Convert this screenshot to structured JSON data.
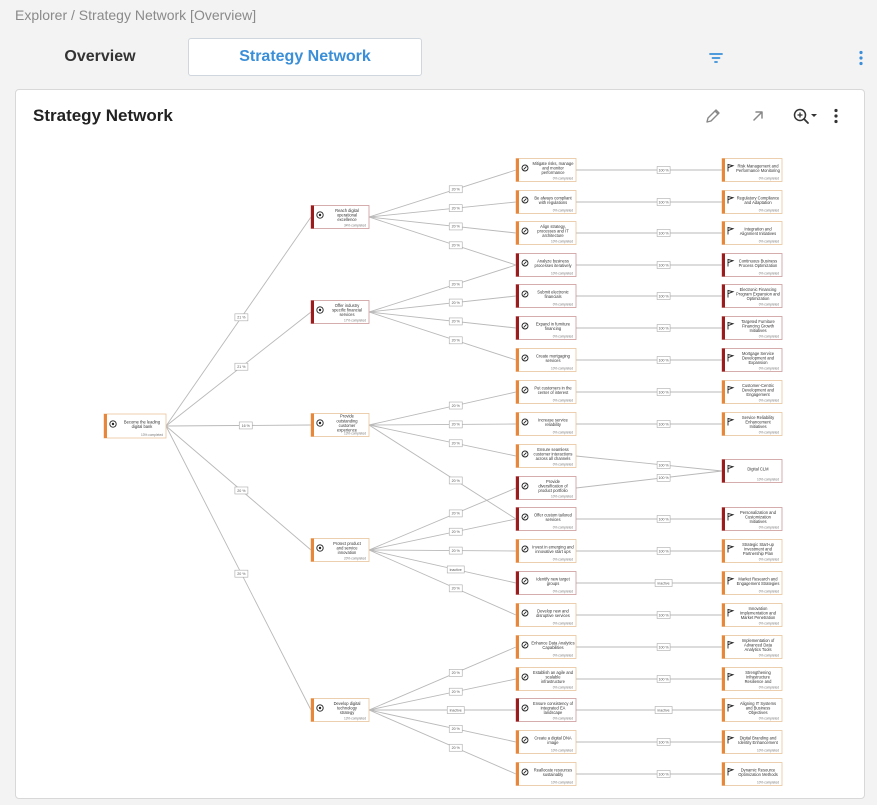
{
  "breadcrumb": "Explorer / Strategy Network [Overview]",
  "tabs": {
    "overview": "Overview",
    "strategy_network": "Strategy Network"
  },
  "panel": {
    "title": "Strategy Network"
  },
  "icons": {
    "filter": "filter-icon",
    "more": "more-vert-icon",
    "edit": "pencil-icon",
    "expand": "arrow-up-right-icon",
    "zoom": "zoom-in-icon"
  },
  "colors": {
    "accent": "#3a8fd8",
    "dark_red": "#9b1c1c",
    "orange": "#e8873a",
    "edge": "#b9b9b9"
  },
  "network": {
    "root": {
      "label": "Become the leading digital bank",
      "status": "13% completed"
    },
    "goals": [
      {
        "label": "Reach digital operational excellence",
        "status": "34% completed",
        "type": "dark",
        "edge_label": "21 %"
      },
      {
        "label": "Offer industry specific financial services",
        "status": "17% completed",
        "type": "dark",
        "edge_label": "21 %"
      },
      {
        "label": "Provide outstanding customer experience",
        "status": "13% completed",
        "type": "light",
        "edge_label": "16 %"
      },
      {
        "label": "Protect product and service innovation",
        "status": "20% completed",
        "type": "light",
        "edge_label": "20 %"
      },
      {
        "label": "Develop digital technology strategy",
        "status": "13% completed",
        "type": "light",
        "edge_label": "20 %"
      }
    ],
    "objectives": [
      {
        "label": "Mitigate risks, manage and monitor performance",
        "status": "0% completed",
        "type": "light"
      },
      {
        "label": "Be always compliant with regulations",
        "status": "0% completed",
        "type": "light"
      },
      {
        "label": "Align strategy, processes and IT architecture",
        "status": "10% completed",
        "type": "light"
      },
      {
        "label": "Analyze business processes iteratively",
        "status": "10% completed",
        "type": "dark"
      },
      {
        "label": "Submit electronic financials",
        "status": "0% completed",
        "type": "dark"
      },
      {
        "label": "Expand in furniture financing",
        "status": "0% completed",
        "type": "dark"
      },
      {
        "label": "Create mortgaging services",
        "status": "10% completed",
        "type": "light"
      },
      {
        "label": "Put customers in the center of interest",
        "status": "0% completed",
        "type": "light"
      },
      {
        "label": "Increase service reliability",
        "status": "0% completed",
        "type": "light"
      },
      {
        "label": "Ensure seamless customer interactions across all channels",
        "status": "0% completed",
        "type": "light"
      },
      {
        "label": "Provide diversification of product portfolio",
        "status": "10% completed",
        "type": "dark"
      },
      {
        "label": "Offer custom tailored services",
        "status": "0% completed",
        "type": "dark"
      },
      {
        "label": "Invest in emerging and innovative start ups",
        "status": "0% completed",
        "type": "light"
      },
      {
        "label": "Identify new target groups",
        "status": "0% completed",
        "type": "dark"
      },
      {
        "label": "Develop new and disruptive services",
        "status": "0% completed",
        "type": "light"
      },
      {
        "label": "Enhance Data Analytics Capabilities",
        "status": "0% completed",
        "type": "light"
      },
      {
        "label": "Establish an agile and scalable infrastructure",
        "status": "0% completed",
        "type": "light"
      },
      {
        "label": "Ensure consistency of integrated EA landscape",
        "status": "0% completed",
        "type": "dark"
      },
      {
        "label": "Create a digital DNA image",
        "status": "10% completed",
        "type": "light"
      },
      {
        "label": "Reallocate resources sustainably",
        "status": "10% completed",
        "type": "light"
      }
    ],
    "initiatives": [
      {
        "label": "Risk Management and Performance Monitoring",
        "status": "0% completed",
        "type": "light"
      },
      {
        "label": "Regulatory Compliance and Adaptation",
        "status": "0% completed",
        "type": "light"
      },
      {
        "label": "Integration and Alignment Initiatives",
        "status": "0% completed",
        "type": "light"
      },
      {
        "label": "Continuous Business Process Optimization",
        "status": "0% completed",
        "type": "dark"
      },
      {
        "label": "Electronic Financing Program Expansion and Optimization",
        "status": "0% completed",
        "type": "dark"
      },
      {
        "label": "Targeted Furniture Financing Growth Initiatives",
        "status": "0% completed",
        "type": "dark"
      },
      {
        "label": "Mortgage Service Development and Expansion",
        "status": "0% completed",
        "type": "dark"
      },
      {
        "label": "Customer-Centric Development and Engagement",
        "status": "0% completed",
        "type": "light"
      },
      {
        "label": "Service Reliability Enhancement Initiatives",
        "status": "0% completed",
        "type": "light"
      },
      {
        "label": "Digital CLM",
        "status": "10% completed",
        "type": "dark"
      },
      {
        "label": "Personalization and Customization Initiatives",
        "status": "0% completed",
        "type": "dark"
      },
      {
        "label": "Strategic Start-up Investment and Partnership Plan",
        "status": "0% completed",
        "type": "light"
      },
      {
        "label": "Market Research and Engagement Strategies",
        "status": "0% completed",
        "type": "light"
      },
      {
        "label": "Innovation Implementation and Market Penetration",
        "status": "0% completed",
        "type": "light"
      },
      {
        "label": "Implementation of Advanced Data Analytics Tools",
        "status": "0% completed",
        "type": "light"
      },
      {
        "label": "Strengthening Infrastructure Resilience and",
        "status": "0% completed",
        "type": "light"
      },
      {
        "label": "Aligning IT Systems and Business Objectives",
        "status": "0% completed",
        "type": "light"
      },
      {
        "label": "Digital Branding and Identity Enhancement",
        "status": "10% completed",
        "type": "light"
      },
      {
        "label": "Dynamic Resource Optimization Methods",
        "status": "10% completed",
        "type": "light"
      }
    ],
    "goal_objective_links": [
      {
        "goal": 0,
        "objective": 0,
        "label": "20 %"
      },
      {
        "goal": 0,
        "objective": 1,
        "label": "20 %"
      },
      {
        "goal": 0,
        "objective": 2,
        "label": "20 %"
      },
      {
        "goal": 0,
        "objective": 3,
        "label": "20 %"
      },
      {
        "goal": 1,
        "objective": 3,
        "label": "20 %"
      },
      {
        "goal": 1,
        "objective": 4,
        "label": "20 %"
      },
      {
        "goal": 1,
        "objective": 5,
        "label": "20 %"
      },
      {
        "goal": 1,
        "objective": 6,
        "label": "20 %"
      },
      {
        "goal": 2,
        "objective": 7,
        "label": "20 %"
      },
      {
        "goal": 2,
        "objective": 8,
        "label": "20 %"
      },
      {
        "goal": 2,
        "objective": 9,
        "label": "20 %"
      },
      {
        "goal": 2,
        "objective": 11,
        "label": "20 %"
      },
      {
        "goal": 3,
        "objective": 10,
        "label": "20 %"
      },
      {
        "goal": 3,
        "objective": 11,
        "label": "20 %"
      },
      {
        "goal": 3,
        "objective": 12,
        "label": "20 %"
      },
      {
        "goal": 3,
        "objective": 13,
        "label": "inactive"
      },
      {
        "goal": 3,
        "objective": 14,
        "label": "20 %"
      },
      {
        "goal": 4,
        "objective": 15,
        "label": "20 %"
      },
      {
        "goal": 4,
        "objective": 16,
        "label": "20 %"
      },
      {
        "goal": 4,
        "objective": 17,
        "label": "inactive"
      },
      {
        "goal": 4,
        "objective": 18,
        "label": "20 %"
      },
      {
        "goal": 4,
        "objective": 19,
        "label": "20 %"
      }
    ],
    "objective_initiative_links": [
      {
        "objective": 0,
        "initiative": 0,
        "label": "100 %"
      },
      {
        "objective": 1,
        "initiative": 1,
        "label": "100 %"
      },
      {
        "objective": 2,
        "initiative": 2,
        "label": "100 %"
      },
      {
        "objective": 3,
        "initiative": 3,
        "label": "100 %"
      },
      {
        "objective": 4,
        "initiative": 4,
        "label": "100 %"
      },
      {
        "objective": 5,
        "initiative": 5,
        "label": "100 %"
      },
      {
        "objective": 6,
        "initiative": 6,
        "label": "100 %"
      },
      {
        "objective": 7,
        "initiative": 7,
        "label": "100 %"
      },
      {
        "objective": 8,
        "initiative": 8,
        "label": "100 %"
      },
      {
        "objective": 9,
        "initiative": 9,
        "label": "100 %"
      },
      {
        "objective": 10,
        "initiative": 9,
        "label": "100 %"
      },
      {
        "objective": 11,
        "initiative": 10,
        "label": "100 %"
      },
      {
        "objective": 12,
        "initiative": 11,
        "label": "100 %"
      },
      {
        "objective": 13,
        "initiative": 12,
        "label": "inactive"
      },
      {
        "objective": 14,
        "initiative": 13,
        "label": "100 %"
      },
      {
        "objective": 15,
        "initiative": 14,
        "label": "100 %"
      },
      {
        "objective": 16,
        "initiative": 15,
        "label": "100 %"
      },
      {
        "objective": 17,
        "initiative": 16,
        "label": "inactive"
      },
      {
        "objective": 18,
        "initiative": 17,
        "label": "100 %"
      },
      {
        "objective": 19,
        "initiative": 18,
        "label": "100 %"
      }
    ]
  }
}
